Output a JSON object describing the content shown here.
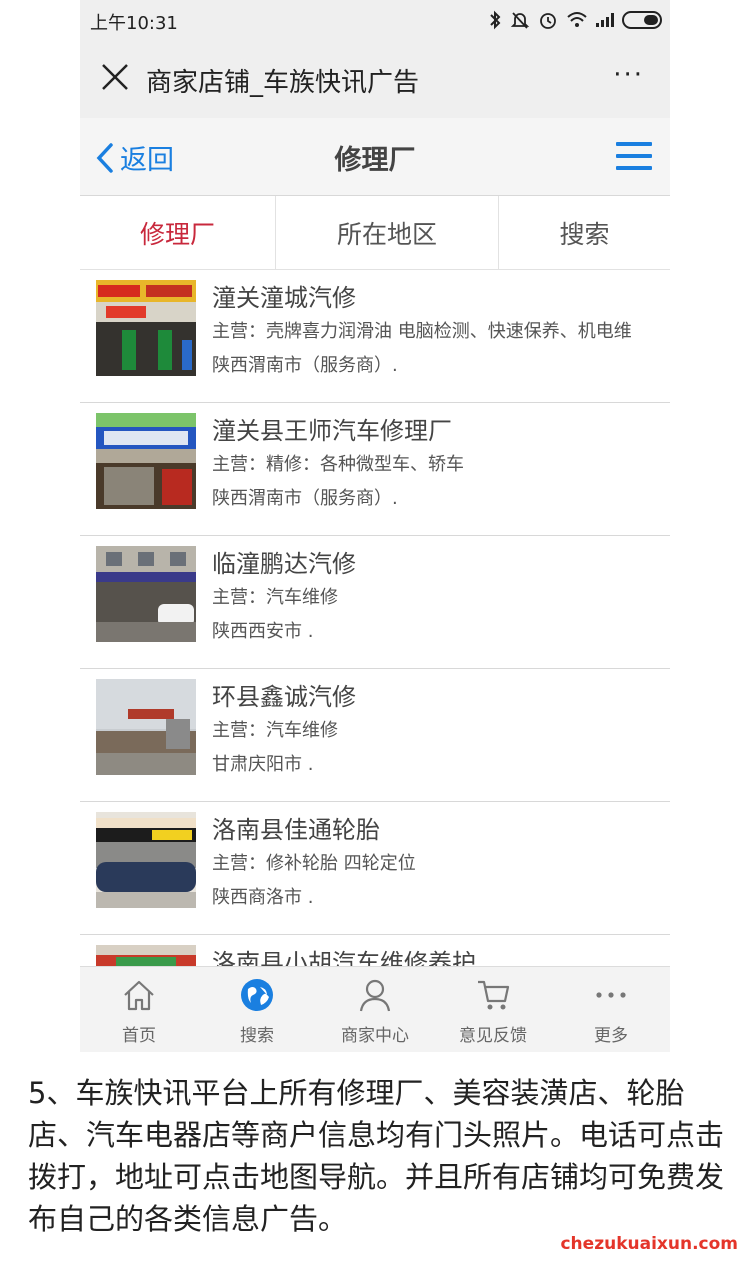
{
  "status_bar": {
    "time": "上午10:31",
    "icons": [
      "bluetooth-icon",
      "mute-icon",
      "alarm-icon",
      "wifi-icon",
      "signal-icon",
      "battery-icon"
    ],
    "battery_level": 0.45
  },
  "wechat_bar": {
    "title": "商家店铺_车族快讯广告",
    "more": "···"
  },
  "header": {
    "back_label": "返回",
    "title": "修理厂"
  },
  "tabs": [
    {
      "label": "修理厂",
      "active": true
    },
    {
      "label": "所在地区",
      "active": false
    },
    {
      "label": "搜索",
      "active": false
    }
  ],
  "shops": [
    {
      "name": "潼关潼城汽修",
      "main": "主营：壳牌喜力润滑油 电脑检测、快速保养、机电维",
      "location": "陕西渭南市（服务商）."
    },
    {
      "name": "潼关县王师汽车修理厂",
      "main": "主营：精修：各种微型车、轿车",
      "location": "陕西渭南市（服务商）."
    },
    {
      "name": "临潼鹏达汽修",
      "main": "主营：汽车维修",
      "location": "陕西西安市 ."
    },
    {
      "name": "环县鑫诚汽修",
      "main": "主营：汽车维修",
      "location": "甘肃庆阳市 ."
    },
    {
      "name": "洛南县佳通轮胎",
      "main": "主营：修补轮胎 四轮定位",
      "location": "陕西商洛市 ."
    },
    {
      "name": "洛南县小胡汽车维修养护",
      "main": "",
      "location": ""
    }
  ],
  "bottom_nav": [
    {
      "label": "首页",
      "icon": "home-icon"
    },
    {
      "label": "搜索",
      "icon": "globe-icon"
    },
    {
      "label": "商家中心",
      "icon": "user-icon"
    },
    {
      "label": "意见反馈",
      "icon": "cart-icon"
    },
    {
      "label": "更多",
      "icon": "more-icon"
    }
  ],
  "caption": "5、车族快讯平台上所有修理厂、美容装潢店、轮胎店、汽车电器店等商户信息均有门头照片。电话可点击拨打，地址可点击地图导航。并且所有店铺均可免费发布自己的各类信息广告。",
  "watermark": "chezukuaixun.com",
  "colors": {
    "accent_blue": "#1a7fe0",
    "active_tab_red": "#c8283c",
    "watermark_red": "#e4352a"
  }
}
